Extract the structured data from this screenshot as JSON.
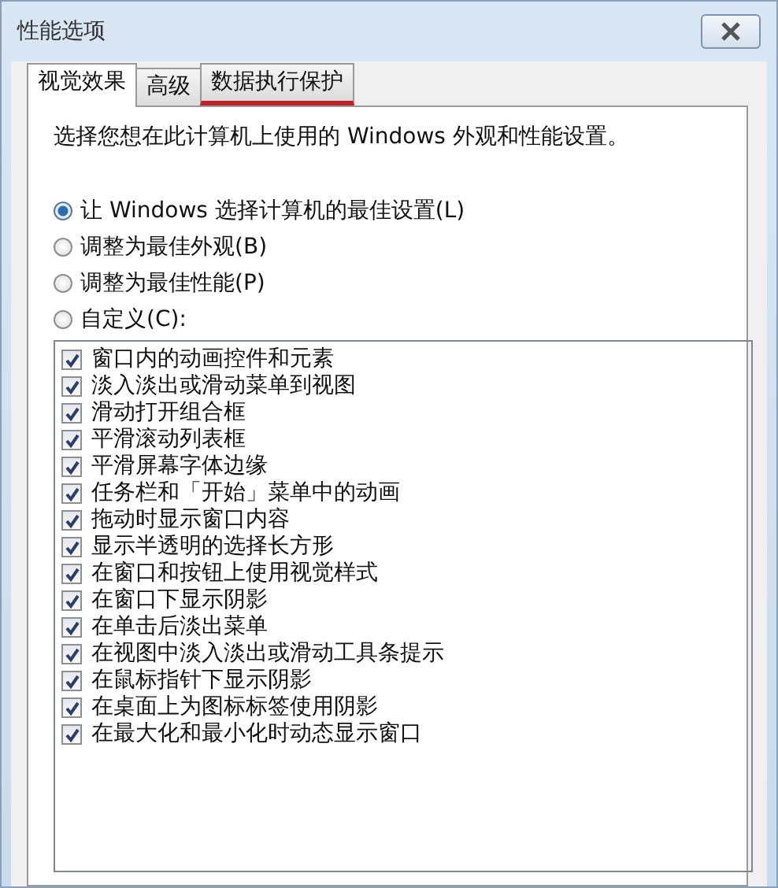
{
  "window": {
    "title": "性能选项"
  },
  "tabs": [
    {
      "label": "视觉效果",
      "selected": true,
      "underlined": false
    },
    {
      "label": "高级",
      "selected": false,
      "underlined": false
    },
    {
      "label": "数据执行保护",
      "selected": false,
      "underlined": true
    }
  ],
  "intro": "选择您想在此计算机上使用的 Windows 外观和性能设置。",
  "options": [
    {
      "label": "让 Windows 选择计算机的最佳设置(L)",
      "selected": true
    },
    {
      "label": "调整为最佳外观(B)",
      "selected": false
    },
    {
      "label": "调整为最佳性能(P)",
      "selected": false
    },
    {
      "label": "自定义(C):",
      "selected": false
    }
  ],
  "effects": [
    {
      "label": "窗口内的动画控件和元素",
      "checked": true
    },
    {
      "label": "淡入淡出或滑动菜单到视图",
      "checked": true
    },
    {
      "label": "滑动打开组合框",
      "checked": true
    },
    {
      "label": "平滑滚动列表框",
      "checked": true
    },
    {
      "label": "平滑屏幕字体边缘",
      "checked": true
    },
    {
      "label": "任务栏和「开始」菜单中的动画",
      "checked": true
    },
    {
      "label": "拖动时显示窗口内容",
      "checked": true
    },
    {
      "label": "显示半透明的选择长方形",
      "checked": true
    },
    {
      "label": "在窗口和按钮上使用视觉样式",
      "checked": true
    },
    {
      "label": "在窗口下显示阴影",
      "checked": true
    },
    {
      "label": "在单击后淡出菜单",
      "checked": true
    },
    {
      "label": "在视图中淡入淡出或滑动工具条提示",
      "checked": true
    },
    {
      "label": "在鼠标指针下显示阴影",
      "checked": true
    },
    {
      "label": "在桌面上为图标标签使用阴影",
      "checked": true
    },
    {
      "label": "在最大化和最小化时动态显示窗口",
      "checked": true
    }
  ]
}
